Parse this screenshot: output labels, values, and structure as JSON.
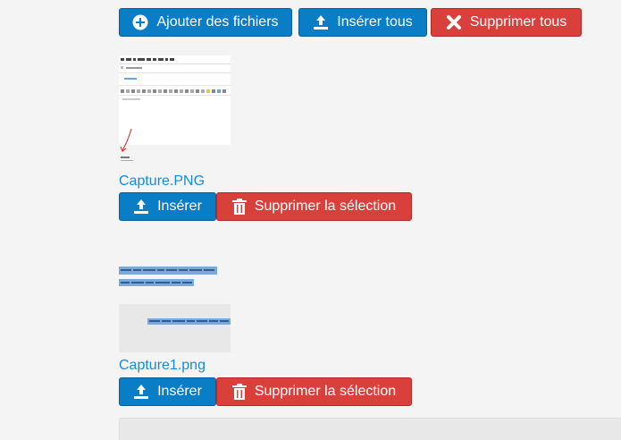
{
  "toolbar": {
    "add_label": "Ajouter des fichiers",
    "insert_all_label": "Insérer tous",
    "delete_all_label": "Supprimer tous"
  },
  "files": [
    {
      "name": "Capture.PNG",
      "insert_label": "Insérer",
      "delete_label": "Supprimer la sélection"
    },
    {
      "name": "Capture1.png",
      "insert_label": "Insérer",
      "delete_label": "Supprimer la sélection"
    }
  ],
  "colors": {
    "primary": "#0a7dc7",
    "danger": "#d9403b",
    "link": "#1a8ad4",
    "background": "#f4f4f4"
  }
}
